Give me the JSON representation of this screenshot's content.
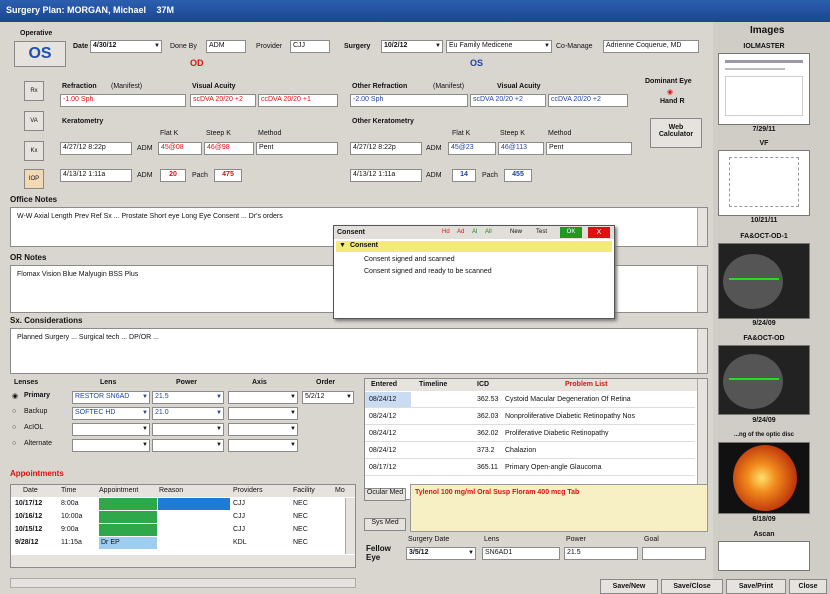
{
  "window": {
    "title": "Surgery Plan: MORGAN, Michael",
    "age": "37M"
  },
  "operative": {
    "label": "Operative",
    "eye": "OS"
  },
  "header": {
    "date_label": "Date",
    "date": "4/30/12",
    "done_by_label": "Done By",
    "done_by": "ADM",
    "provider_label": "Provider",
    "provider": "CJJ",
    "surgery_label": "Surgery",
    "surgery_date": "10/2/12",
    "surgery_type": "Eu Family Medicene",
    "comanage_label": "Co-Manage",
    "comanage": "Adrienne Coquerue, MD",
    "od": "OD",
    "os": "OS"
  },
  "side_buttons": [
    "Rx",
    "VA",
    "Kx",
    "IOP"
  ],
  "refraction": {
    "label": "Refraction",
    "sub": "(Manifest)",
    "value": "-1.00 Sph",
    "va_label": "Visual Acuity",
    "va1": "scDVA 20/20 +2",
    "va2": "ccDVA 20/20 +1",
    "other_label": "Other Refraction",
    "other_sub": "(Manifest)",
    "other_value": "-2.00 Sph",
    "other_va_label": "Visual Acuity",
    "other_va1": "scDVA 20/20 +2",
    "other_va2": "ccDVA 20/20 +2"
  },
  "dominant": {
    "label": "Dominant Eye",
    "value": "Hand R"
  },
  "keratometry": {
    "label": "Keratometry",
    "flat_label": "Flat K",
    "steep_label": "Steep K",
    "method_label": "Method",
    "date": "4/27/12 8:22p",
    "by": "ADM",
    "flat": "45@08",
    "steep": "46@98",
    "method": "Pent",
    "iop_date": "4/13/12 1:11a",
    "iop_by": "ADM",
    "iop": "20",
    "pach_label": "Pach",
    "pach": "475"
  },
  "other_keratometry": {
    "label": "Other Keratometry",
    "flat_label": "Flat K",
    "steep_label": "Steep K",
    "method_label": "Method",
    "date": "4/27/12 8:22p",
    "by": "ADM",
    "flat": "45@23",
    "steep": "46@113",
    "method": "Pent",
    "iop_date": "4/13/12 1:11a",
    "iop_by": "ADM",
    "iop": "14",
    "pach_label": "Pach",
    "pach": "455"
  },
  "web_calc": "Web Calculator",
  "office_notes": {
    "label": "Office Notes",
    "text": "W-W    Axial Length    Prev Ref Sx ...    Prostate    Short eye    Long Eye    Consent ...    Dr's orders"
  },
  "or_notes": {
    "label": "OR Notes",
    "text": "Flomax   Vision Blue   Malyugin   BSS Plus"
  },
  "sx_considerations": {
    "label": "Sx. Considerations",
    "text": "Planned Surgery ...    Surgical tech ...    DP/OR ..."
  },
  "consent": {
    "title": "Consent",
    "icons": [
      "Hd",
      "Ad",
      "Al",
      "All",
      "New",
      "Test",
      "OK",
      "X"
    ],
    "group": "Consent",
    "items": [
      "Consent signed and scanned",
      "Consent signed and ready to be scanned"
    ]
  },
  "lenses": {
    "headers": [
      "Lenses",
      "Lens",
      "Power",
      "Axis",
      "Order"
    ],
    "rows": [
      {
        "label": "Primary",
        "lens": "RESTOR SN6AD",
        "power": "21.5",
        "axis": "",
        "order": "5/2/12"
      },
      {
        "label": "Backup",
        "lens": "SOFTEC HD",
        "power": "21.0",
        "axis": "",
        "order": ""
      },
      {
        "label": "AcIOL",
        "lens": "",
        "power": "",
        "axis": "",
        "order": ""
      },
      {
        "label": "Alternate",
        "lens": "",
        "power": "",
        "axis": "",
        "order": ""
      }
    ]
  },
  "problems": {
    "headers": [
      "Entered",
      "Timeline",
      "ICD",
      "Problem List"
    ],
    "rows": [
      [
        "08/24/12",
        "",
        "362.53",
        "Cystoid Macular Degeneration Of Retina"
      ],
      [
        "08/24/12",
        "",
        "362.03",
        "Nonproliferative Diabetic Retinopathy Nos"
      ],
      [
        "08/24/12",
        "",
        "362.02",
        "Proliferative Diabetic Retinopathy"
      ],
      [
        "08/24/12",
        "",
        "373.2",
        "Chalazion"
      ],
      [
        "08/17/12",
        "",
        "365.11",
        "Primary Open-angle Glaucoma"
      ]
    ]
  },
  "appointments": {
    "label": "Appointments",
    "headers": [
      "Date",
      "Time",
      "Appointment",
      "Reason",
      "Providers",
      "Facility",
      "Mo"
    ],
    "rows": [
      [
        "10/17/12",
        "8:00a",
        "",
        "",
        "CJJ",
        "NEC",
        ""
      ],
      [
        "10/16/12",
        "10:00a",
        "",
        "",
        "CJJ",
        "NEC",
        ""
      ],
      [
        "10/15/12",
        "9:00a",
        "",
        "",
        "CJJ",
        "NEC",
        ""
      ],
      [
        "9/28/12",
        "11:15a",
        "Dr EP",
        "",
        "KDL",
        "NEC",
        ""
      ]
    ]
  },
  "meds": {
    "ocular_btn": "Ocular Med",
    "sys_btn": "Sys Med",
    "text": "Tylenol 100 mg/ml Oral Susp Floram 400 mcg Tab"
  },
  "fellow_eye": {
    "label": "Fellow Eye",
    "surgery_date_label": "Surgery Date",
    "surgery_date": "3/5/12",
    "lens_label": "Lens",
    "lens": "SN6AD1",
    "power_label": "Power",
    "power": "21.5",
    "goal_label": "Goal",
    "goal": ""
  },
  "images": {
    "title": "Images",
    "items": [
      {
        "name": "IOLMASTER",
        "date": "7/29/11"
      },
      {
        "name": "VF",
        "date": "10/21/11"
      },
      {
        "name": "FA&OCT-OD-1",
        "date": "9/24/09"
      },
      {
        "name": "FA&OCT-OD",
        "date": "9/24/09"
      },
      {
        "name": "...ng of the optic disc",
        "date": "6/18/09"
      },
      {
        "name": "Ascan",
        "date": ""
      }
    ]
  },
  "footer": [
    "Save/New",
    "Save/Close",
    "Save/Print",
    "Close"
  ]
}
